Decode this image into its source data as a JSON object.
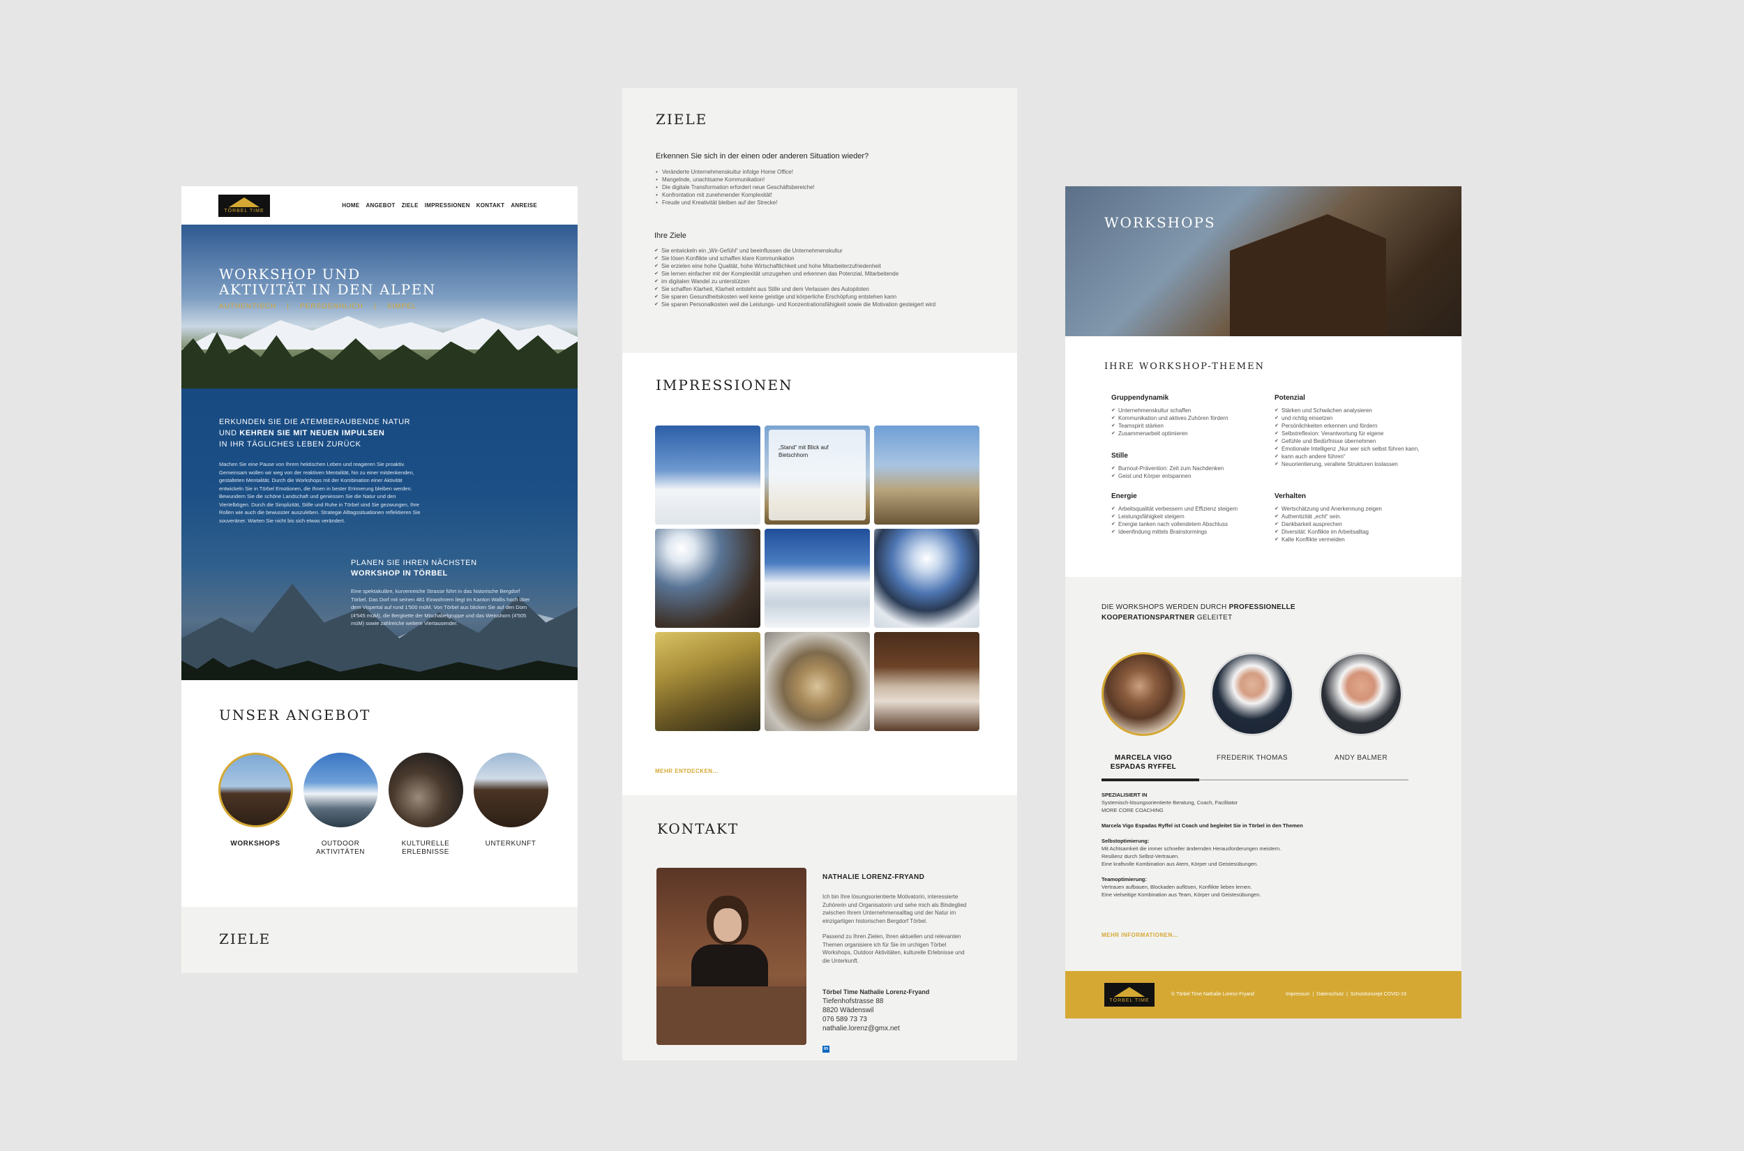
{
  "panel1": {
    "logo_text": "TÖRBEL TIME",
    "nav": [
      "HOME",
      "ANGEBOT",
      "ZIELE",
      "IMPRESSIONEN",
      "KONTAKT",
      "ANREISE"
    ],
    "hero_title_1": "WORKSHOP UND",
    "hero_title_2": "AKTIVITÄT IN DEN ALPEN",
    "hero_tagline": "AUTHENTISCH    |    PERSOENHLICH    |    SIMPEL",
    "intro_h1": "ERKUNDEN SIE DIE ATEMBERAUBENDE NATUR",
    "intro_h2a": "UND ",
    "intro_h2b": "KEHREN SIE MIT NEUEN IMPULSEN",
    "intro_h3": "IN IHR TÄGLICHES LEBEN ZURÜCK",
    "intro_p": "Machen Sie eine Pause von Ihrem hektischen Leben und reagieren Sie proaktiv. Gemeinsam wollen wir weg von der reaktiven Mentalität, hin zu einer mitdenkenden, gestalteten Mentalität. Durch die Workshops mit der Kombination einer Aktivität entwickeln Sie in Törbel Emotionen, die Ihnen in bester Erinnerung bleiben werden. Bewundern Sie die schöne Landschaft und geniessen Sie die Natur und den Viertelbögen. Durch die Simplizität, Stille und Ruhe in Törbel sind Sie gezwungen, Ihre Rollen wie auch die bewusster auszuleben. Strategie Alltagssituationen reflektieren Sie souveräner. Warten Sie nicht bis sich etwas verändert.",
    "plan_h1": "PLANEN SIE IHREN NÄCHSTEN",
    "plan_h2": "WORKSHOP IN TÖRBEL",
    "plan_p": "Eine spektakuläre, kurvenreiche Strasse führt in das historische Bergdorf Törbel. Das Dorf mit seinen 481 Einwohnern liegt im Kanton Wallis hoch über dem Vispertal auf rund 1'500 müM. Von Törbel aus blicken Sie auf den Dom (4'545 müM), die Bergkette der Mischabelgruppe und das Weisshorn (4'505 müM) sowie zahlreiche weitere Viertausender.",
    "angebot_title": "UNSER ANGEBOT",
    "angebot_items": [
      {
        "label": "WORKSHOPS"
      },
      {
        "label": "OUTDOOR AKTIVITÄTEN"
      },
      {
        "label": "KULTURELLE ERLEBNISSE"
      },
      {
        "label": "UNTERKUNFT"
      }
    ],
    "ziele_title": "ZIELE"
  },
  "panel2": {
    "ziele_title": "ZIELE",
    "question": "Erkennen Sie sich in der einen oder anderen Situation wieder?",
    "situations": [
      "Veränderte Unternehmenskultur infolge Home Office!",
      "Mangelnde, unachtsame Kommunikation!",
      "Die digitale Transformation erfordert neue Geschäftsbereiche!",
      "Konfrontation mit zunehmender Komplexität!",
      "Freude und Kreativität bleiben auf der Strecke!"
    ],
    "ihre_ziele_title": "Ihre Ziele",
    "ziele": [
      "Sie entwickeln ein „Wir-Gefühl“ und beeinflussen die Unternehmenskultur",
      "Sie lösen Konflikte und schaffen klare Kommunikation",
      "Sie erzielen eine hohe Qualität, hohe Wirtschaftlichkeit und hohe Mitarbeiterzufriedenheit",
      "Sie lernen einfacher mit der Komplexität umzugehen und erkennen das Potenzial, Mitarbeitende",
      "im digitalen Wandel zu unterstützen",
      "Sie schaffen Klarheit, Klarheit entsteht aus Stille und dem Verlassen des Autopiloten",
      "Sie sparen Gesundheitskosten weil keine geistige und körperliche Erschöpfung entstehen kann",
      "Sie sparen Personalkosten weil die Leistungs- und Konzentrationsfähigkeit sowie die Motivation gesteigert wird"
    ],
    "impressionen_title": "IMPRESSIONEN",
    "tile_caption": "„Stand“ mit Blick auf Bietschhorn",
    "mehr_entdecken": "MEHR ENTDECKEN...",
    "kontakt_title": "KONTAKT",
    "contact_name": "NATHALIE LORENZ-FRYAND",
    "contact_p1": "Ich bin Ihre lösungsorientierte Motivatorin, interessierte Zuhörerin und Organisatorin und sehe mich als Bindeglied zwischen Ihrem Unternehmensalltag und der Natur im einzigartigen historischen Bergdorf Törbel.",
    "contact_p2": "Passend zu Ihren Zielen, Ihren aktuellen und relevanten Themen organisiere ich für Sie im urchigen Törbel Workshops, Outdoor Aktivitäten, kulturelle Erlebnisse und die Unterkunft.",
    "addr_company": "Törbel Time Nathalie Lorenz-Fryand",
    "addr_street": "Tiefenhofstrasse 88",
    "addr_city": "8820 Wädenswil",
    "addr_phone": "076 589 73 73",
    "addr_email": "nathalie.lorenz@gmx.net",
    "linkedin": "in"
  },
  "panel3": {
    "hero_title": "WORKSHOPS",
    "themen_title": "IHRE WORKSHOP-THEMEN",
    "themes": {
      "gruppendynamik": {
        "title": "Gruppendynamik",
        "items": [
          "Unternehmenskultur schaffen",
          "Kommunikation und aktives Zuhören fördern",
          "Teamspirit stärken",
          "Zusammenarbeit optimieren"
        ]
      },
      "stille": {
        "title": "Stille",
        "items": [
          "Burnout-Prävention: Zeit zum Nachdenken",
          "Geist und Körper entspannen"
        ]
      },
      "energie": {
        "title": "Energie",
        "items": [
          "Arbeitsqualität verbessern und Effizienz steigern",
          "Leistungsfähigkeit steigern",
          "Energie tanken nach vollendetem Abschluss",
          "Ideenfindung mittels Brainstormings"
        ]
      },
      "potenzial": {
        "title": "Potenzial",
        "items": [
          "Stärken und Schwächen analysieren",
          "und richtig einsetzen",
          "Persönlichkeiten erkennen und fördern",
          "Selbstreflexion: Verantwortung für eigene",
          "Gefühle und Bedürfnisse übernehmen",
          "Emotionale Intelligenz „Nur wer sich selbst führen kann,",
          "kann auch andere führen“",
          "Neuorientierung, veraltete Strukturen loslassen"
        ]
      },
      "verhalten": {
        "title": "Verhalten",
        "items": [
          "Wertschätzung und Anerkennung zeigen",
          "Authentizität „echt“ sein.",
          "Dankbarkeit ausprechen",
          "Diversität: Konflikte im Arbeitsalltag",
          "Kalte Konflikte vermeiden"
        ]
      }
    },
    "partner_h1": "DIE WORKSHOPS WERDEN DURCH ",
    "partner_h1b": "PROFESSIONELLE",
    "partner_h2b": "KOOPERATIONSPARTNER",
    "partner_h2": " GELEITET",
    "persons": [
      {
        "name": "MARCELA VIGO ESPADAS RYFFEL"
      },
      {
        "name": "FREDERIK THOMAS"
      },
      {
        "name": "ANDY BALMER"
      }
    ],
    "spez_title": "SPEZIALISIERT IN",
    "spez_1": "Systemisch-lösungsorientierte Beratung, Coach, Facilitator",
    "spez_2": "MORE CORE COACHING",
    "bio": "Marcela Vigo Espadas Ryffel ist Coach und begleitet Sie in Törbel in den Themen",
    "selbst_title": "Selbstoptimierung:",
    "selbst_1": "Mit Achtsamkeit die immer schneller ändernden Herausforderungen meistern.",
    "selbst_2": "Resilienz durch Selbst-Vertrauen.",
    "selbst_3": "Eine kraftvolle Kombination aus Atem, Körper und Geistesübungen.",
    "team_title": "Teamoptimierung:",
    "team_1": "Vertrauen aufbauen, Blockaden auflösen, Konflikte lieben lernen.",
    "team_2": "Eine vielseitige Kombination aus Team, Körper und Geistesübungen.",
    "mehr_info": "MEHR INFORMATIONEN...",
    "footer_copy": "© Törbel Time Nathalie Lorenz-Fryand",
    "footer_links": "Impressum  |  Datenschutz  |  Schutzkonzept COVID-19"
  },
  "colors": {
    "accent": "#d4a833",
    "blue": "#1b4f85",
    "panel_grey": "#f2f2f0"
  }
}
